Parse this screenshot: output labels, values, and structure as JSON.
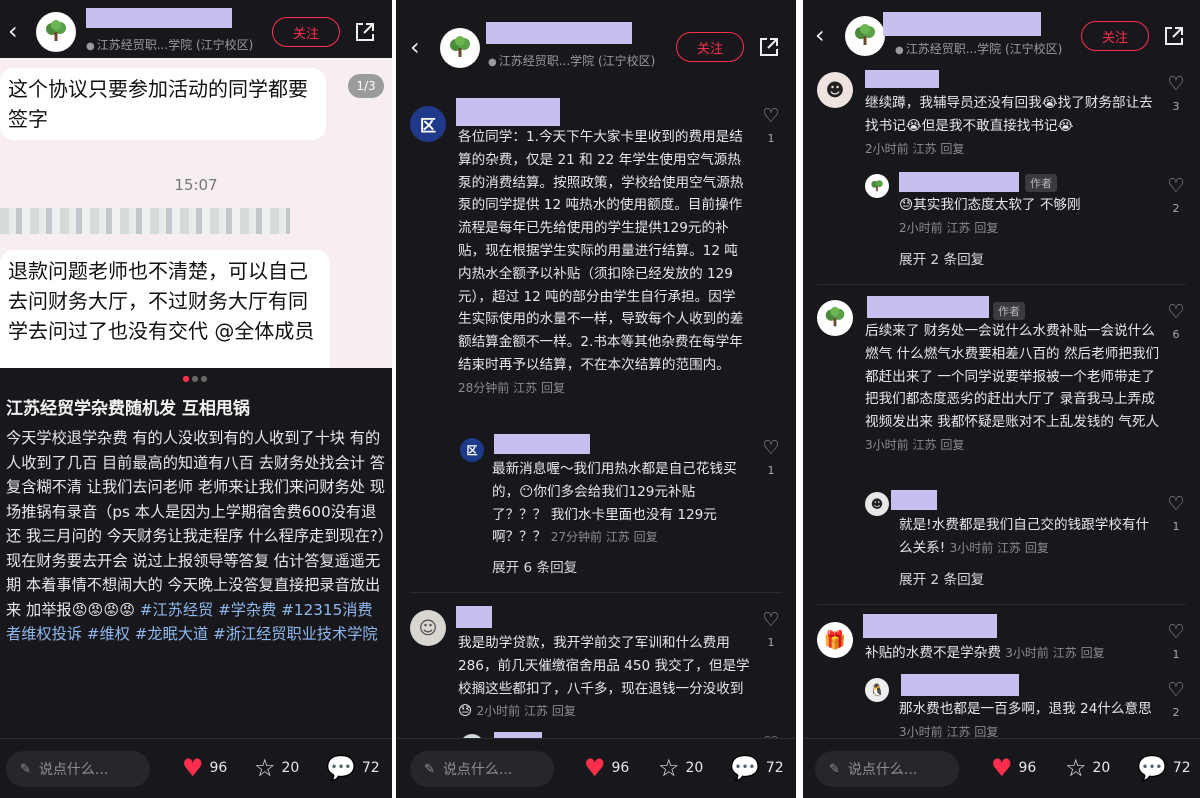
{
  "common": {
    "location": "江苏经贸职...学院 (江宁校区)",
    "follow_label": "关注",
    "comment_placeholder": "说点什么...",
    "likes": "96",
    "favorites": "20",
    "comments": "72",
    "reply_label": "回复",
    "accent_color": "#ff2e4d"
  },
  "panel1": {
    "bubble1": "这个协议只要参加活动的同学都要签字",
    "pager": "1/3",
    "time": "15:07",
    "bubble2": "退款问题老师也不清楚，可以自己去问财务大厅，不过财务大厅有同学去问过了也没有交代 @全体成员",
    "title": "江苏经贸学杂费随机发 互相甩锅",
    "body": "今天学校退学杂费 有的人没收到有的人收到了十块 有的人收到了几百 目前最高的知道有八百 去财务处找会计 答复含糊不清 让我们去问老师 老师来让我们来问财务处 现场推锅有录音（ps 本人是因为上学期宿舍费600没有退还 我三月问的 今天财务让我走程序 什么程序走到现在?）现在财务要去开会  说过上报领导等答复 估计答复遥遥无期 本着事情不想闹大的 今天晚上没答复直接把录音放出来 加举报😡😡😡😡",
    "tags": [
      "#江苏经贸",
      "#学杂费",
      "#12315消费者维权投诉",
      "#维权",
      "#龙眠大道",
      "#浙江经贸职业技术学院"
    ]
  },
  "panel2": {
    "c1": {
      "avatar_text": "\u0016区",
      "text": "各位同学：1.今天下午大家卡里收到的费用是结算的杂费，仅是 21 和 22 年学生使用空气源热泵的消费结算。按照政策，学校给使用空气源热泵的同学提供 12 吨热水的使用额度。目前操作流程是每年已先给使用的学生提供129元的补贴，现在根据学生实际的用量进行结算。12 吨内热水全额予以补贴（须扣除已经发放的 129 元），超过 12 吨的部分由学生自行承担。因学生实际使用的水量不一样，导致每个人收到的差额结算金额不一样。2.书本等其他杂费在每学年结束时再予以结算，不在本次结算的范围内。",
      "time": "28分钟前",
      "region": "江苏",
      "likes": "1"
    },
    "c1r": {
      "avatar_text": "区",
      "text": "最新消息喔～我们用热水都是自己花钱买的，😶你们多会给我们129元补贴了？？？ 我们水卡里面也没有 129元啊？？？",
      "time": "27分钟前",
      "region": "江苏",
      "likes": "1",
      "expand": "展开 6 条回复"
    },
    "c2": {
      "text": "我是助学贷款，我开学前交了军训和什么费用 286，前几天催缴宿舍用品 450 我交了，但是学校搁这些都扣了，八千多，现在退钱一分没收到😓",
      "time": "2小时前",
      "region": "江苏",
      "likes": "1"
    }
  },
  "panel3": {
    "c1": {
      "text": "继续蹲，我辅导员还没有回我😭找了财务部让去找书记😭但是我不敢直接找书记😭",
      "time": "2小时前",
      "region": "江苏",
      "likes": "3"
    },
    "c1r": {
      "author_badge": "作者",
      "text": "😓其实我们态度太软了 不够刚",
      "time": "2小时前",
      "region": "江苏",
      "likes": "2",
      "expand": "展开 2 条回复"
    },
    "c2": {
      "author_badge": "作者",
      "text": "后续来了 财务处一会说什么水费补贴一会说什么燃气 什么燃气水费要相差八百的 然后老师把我们都赶出来了 一个同学说要举报被一个老师带走了 把我们都态度恶劣的赶出大厅了 录音我马上弄成视频发出来 我都怀疑是账对不上乱发钱的 气死人",
      "time": "3小时前",
      "region": "江苏",
      "likes": "6"
    },
    "c2r": {
      "text": "就是!水费都是我们自己交的钱跟学校有什么关系!",
      "time": "3小时前",
      "region": "江苏",
      "likes": "1",
      "expand": "展开 2 条回复"
    },
    "c3": {
      "text": "补贴的水费不是学杂费",
      "time": "3小时前",
      "region": "江苏",
      "likes": "1"
    },
    "c3r": {
      "text": "那水费也都是一百多啊，退我 24什么意思",
      "time": "3小时前",
      "region": "江苏",
      "likes": "2"
    }
  }
}
